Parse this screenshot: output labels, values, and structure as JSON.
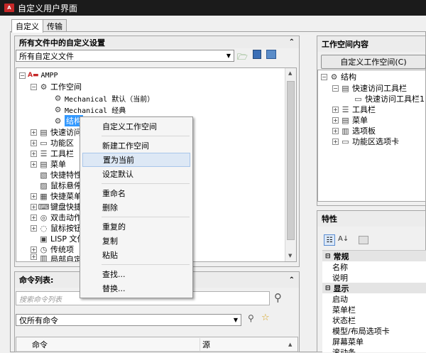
{
  "window": {
    "title": "自定义用户界面"
  },
  "tabs": [
    "自定义",
    "传输"
  ],
  "left_panel": {
    "header": "所有文件中的自定义设置",
    "file_combo": "所有自定义文件",
    "tree": {
      "root": "AMPP",
      "workspaces": "工作空间",
      "ws_items": [
        "Mechanical 默认（当前）",
        "Mechanical 经典",
        "结构"
      ],
      "items": [
        "快速访问",
        "功能区",
        "工具栏",
        "菜单",
        "快捷特性",
        "鼠标悬停",
        "快捷菜单",
        "键盘快捷",
        "双击动作",
        "鼠标按钮",
        "LISP 文件",
        "传统项",
        "局部自定"
      ]
    }
  },
  "context_menu": [
    "自定义工作空间",
    "新建工作空间",
    "置为当前",
    "设定默认",
    "重命名",
    "删除",
    "重复的",
    "复制",
    "粘贴",
    "查找...",
    "替换..."
  ],
  "command_list": {
    "header": "命令列表:",
    "search_placeholder": "搜索命令列表",
    "filter": "仅所有命令",
    "col_command": "命令",
    "col_source": "源"
  },
  "workspace_panel": {
    "header": "工作空间内容",
    "button": "自定义工作空间(C)",
    "tree": {
      "root": "结构",
      "qat": "快速访问工具栏",
      "qat_child": "快速访问工具栏1",
      "items": [
        "工具栏",
        "菜单",
        "选项板",
        "功能区选项卡"
      ]
    }
  },
  "properties": {
    "header": "特性",
    "sections": {
      "general": "常规",
      "display": "显示"
    },
    "general_rows": [
      "名称",
      "说明"
    ],
    "display_rows": [
      "启动",
      "菜单栏",
      "状态栏",
      "模型/布局选项卡",
      "屏幕菜单",
      "滚动条"
    ]
  }
}
